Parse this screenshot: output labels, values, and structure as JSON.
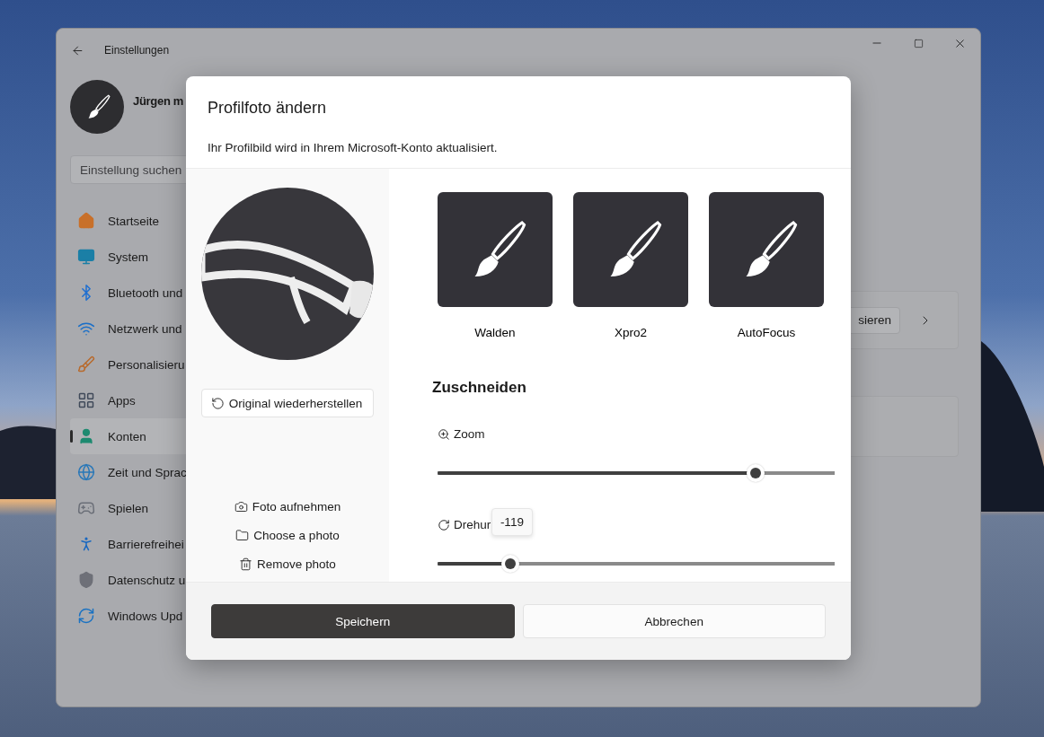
{
  "window": {
    "title": "Einstellungen"
  },
  "profile": {
    "name": "Jürgen m"
  },
  "search": {
    "placeholder": "Einstellung suchen"
  },
  "nav": [
    {
      "label": "Startseite",
      "selected": false
    },
    {
      "label": "System",
      "selected": false
    },
    {
      "label": "Bluetooth und",
      "selected": false
    },
    {
      "label": "Netzwerk und",
      "selected": false
    },
    {
      "label": "Personalisieru",
      "selected": false
    },
    {
      "label": "Apps",
      "selected": false
    },
    {
      "label": "Konten",
      "selected": true
    },
    {
      "label": "Zeit und Sprac",
      "selected": false
    },
    {
      "label": "Spielen",
      "selected": false
    },
    {
      "label": "Barrierefreihei",
      "selected": false
    },
    {
      "label": "Datenschutz u",
      "selected": false
    },
    {
      "label": "Windows Upd",
      "selected": false
    }
  ],
  "content": {
    "card_button": "sieren"
  },
  "dialog": {
    "title": "Profilfoto ändern",
    "subtitle": "Ihr Profilbild wird in Ihrem Microsoft-Konto aktualisiert.",
    "restore_button": "Original wiederherstellen",
    "actions": [
      {
        "label": "Foto aufnehmen"
      },
      {
        "label": "Choose a photo"
      },
      {
        "label": "Remove photo"
      }
    ],
    "filters": [
      {
        "label": "Walden"
      },
      {
        "label": "Xpro2"
      },
      {
        "label": "AutoFocus"
      }
    ],
    "crop": {
      "heading": "Zuschneiden",
      "sliders": [
        {
          "label": "Zoom",
          "level": 0.8
        },
        {
          "label": "Drehur",
          "level": 0.183,
          "tooltip": "-119"
        }
      ]
    },
    "buttons": [
      {
        "label": "Speichern",
        "kind": "primary"
      },
      {
        "label": "Abbrechen",
        "kind": "secondary"
      }
    ]
  }
}
